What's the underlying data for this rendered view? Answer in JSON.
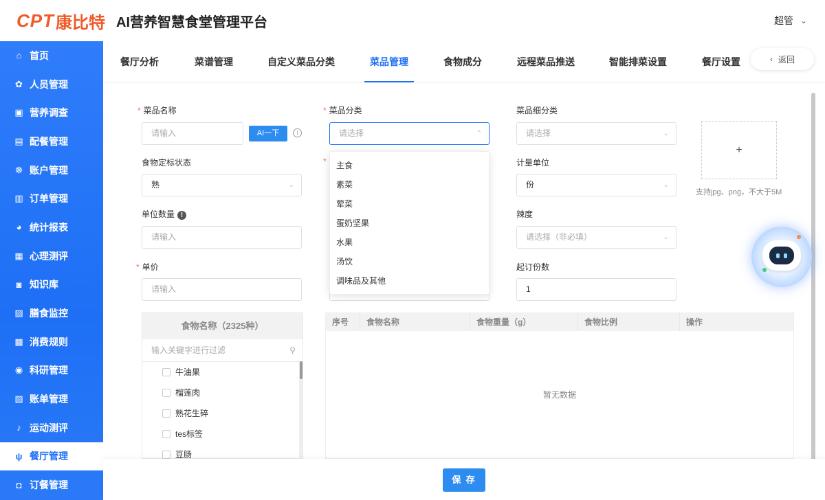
{
  "header": {
    "logo_latin": "CPT",
    "logo_cn": "康比特",
    "title": "AI营养智慧食堂管理平台",
    "user": "超管"
  },
  "sidebar": {
    "items": [
      {
        "label": "首页",
        "icon": "home-icon"
      },
      {
        "label": "人员管理",
        "icon": "people-icon"
      },
      {
        "label": "营养调查",
        "icon": "survey-icon"
      },
      {
        "label": "配餐管理",
        "icon": "meal-icon"
      },
      {
        "label": "账户管理",
        "icon": "account-icon"
      },
      {
        "label": "订单管理",
        "icon": "order-icon"
      },
      {
        "label": "统计报表",
        "icon": "chart-icon"
      },
      {
        "label": "心理测评",
        "icon": "psych-icon"
      },
      {
        "label": "知识库",
        "icon": "knowledge-icon"
      },
      {
        "label": "膳食监控",
        "icon": "monitor-icon"
      },
      {
        "label": "消费规则",
        "icon": "rules-icon"
      },
      {
        "label": "科研管理",
        "icon": "research-icon"
      },
      {
        "label": "账单管理",
        "icon": "bill-icon"
      },
      {
        "label": "运动测评",
        "icon": "sport-icon"
      },
      {
        "label": "餐厅管理",
        "icon": "restaurant-icon",
        "active": true
      },
      {
        "label": "订餐管理",
        "icon": "booking-icon"
      }
    ]
  },
  "tabs": [
    {
      "label": "餐厅分析"
    },
    {
      "label": "菜谱管理"
    },
    {
      "label": "自定义菜品分类"
    },
    {
      "label": "菜品管理",
      "active": true
    },
    {
      "label": "食物成分"
    },
    {
      "label": "远程菜品推送"
    },
    {
      "label": "智能排菜设置"
    },
    {
      "label": "餐厅设置"
    }
  ],
  "back_label": "返回",
  "form": {
    "dish_name": {
      "label": "菜品名称",
      "placeholder": "请输入"
    },
    "ai_button": "AI一下",
    "dish_category": {
      "label": "菜品分类",
      "placeholder": "请选择"
    },
    "dish_subcategory": {
      "label": "菜品细分类",
      "placeholder": "请选择"
    },
    "food_state": {
      "label": "食物定标状态",
      "value": "熟"
    },
    "measure_unit": {
      "label": "计量单位",
      "value": "份"
    },
    "unit_qty": {
      "label": "单位数量",
      "placeholder": "请输入"
    },
    "spicy": {
      "label": "辣度",
      "placeholder": "请选择（非必填）"
    },
    "price": {
      "label": "单价",
      "placeholder": "请输入"
    },
    "min_order": {
      "label": "起订份数",
      "value": "1"
    },
    "upload_hint": "支持jpg、png，不大于5M",
    "upload_plus": "+"
  },
  "category_options": [
    "主食",
    "素菜",
    "荤菜",
    "蛋奶坚果",
    "水果",
    "汤饮",
    "调味品及其他"
  ],
  "food_list": {
    "header": "食物名称（2325种）",
    "filter_placeholder": "输入关键字进行过滤",
    "items": [
      "牛油果",
      "榴莲肉",
      "熟花生碎",
      "tes标签",
      "豆肠"
    ]
  },
  "table": {
    "columns": [
      "序号",
      "食物名称",
      "食物重量（g）",
      "食物比例",
      "操作"
    ],
    "empty_text": "暂无数据"
  },
  "save_label": "保 存",
  "colors": {
    "primary": "#1e6ff5",
    "logo": "#f05a28",
    "required": "#f56c6c"
  }
}
